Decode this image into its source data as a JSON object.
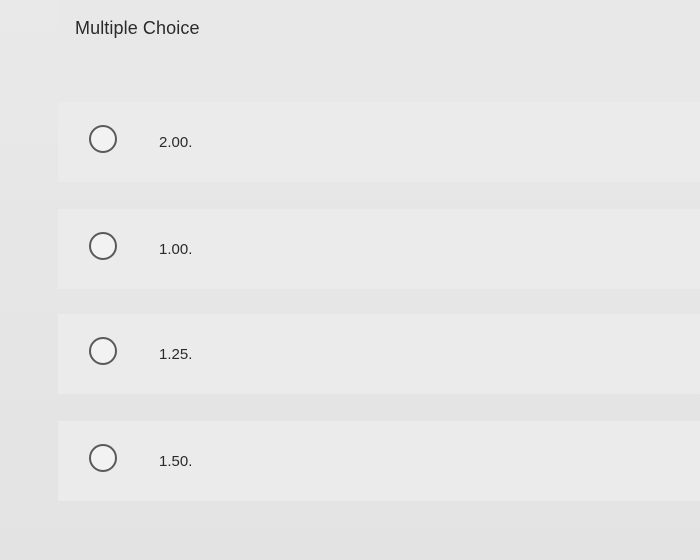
{
  "question": {
    "type_label": "Multiple Choice"
  },
  "options": [
    {
      "label": "2.00."
    },
    {
      "label": "1.00."
    },
    {
      "label": "1.25."
    },
    {
      "label": "1.50."
    }
  ]
}
